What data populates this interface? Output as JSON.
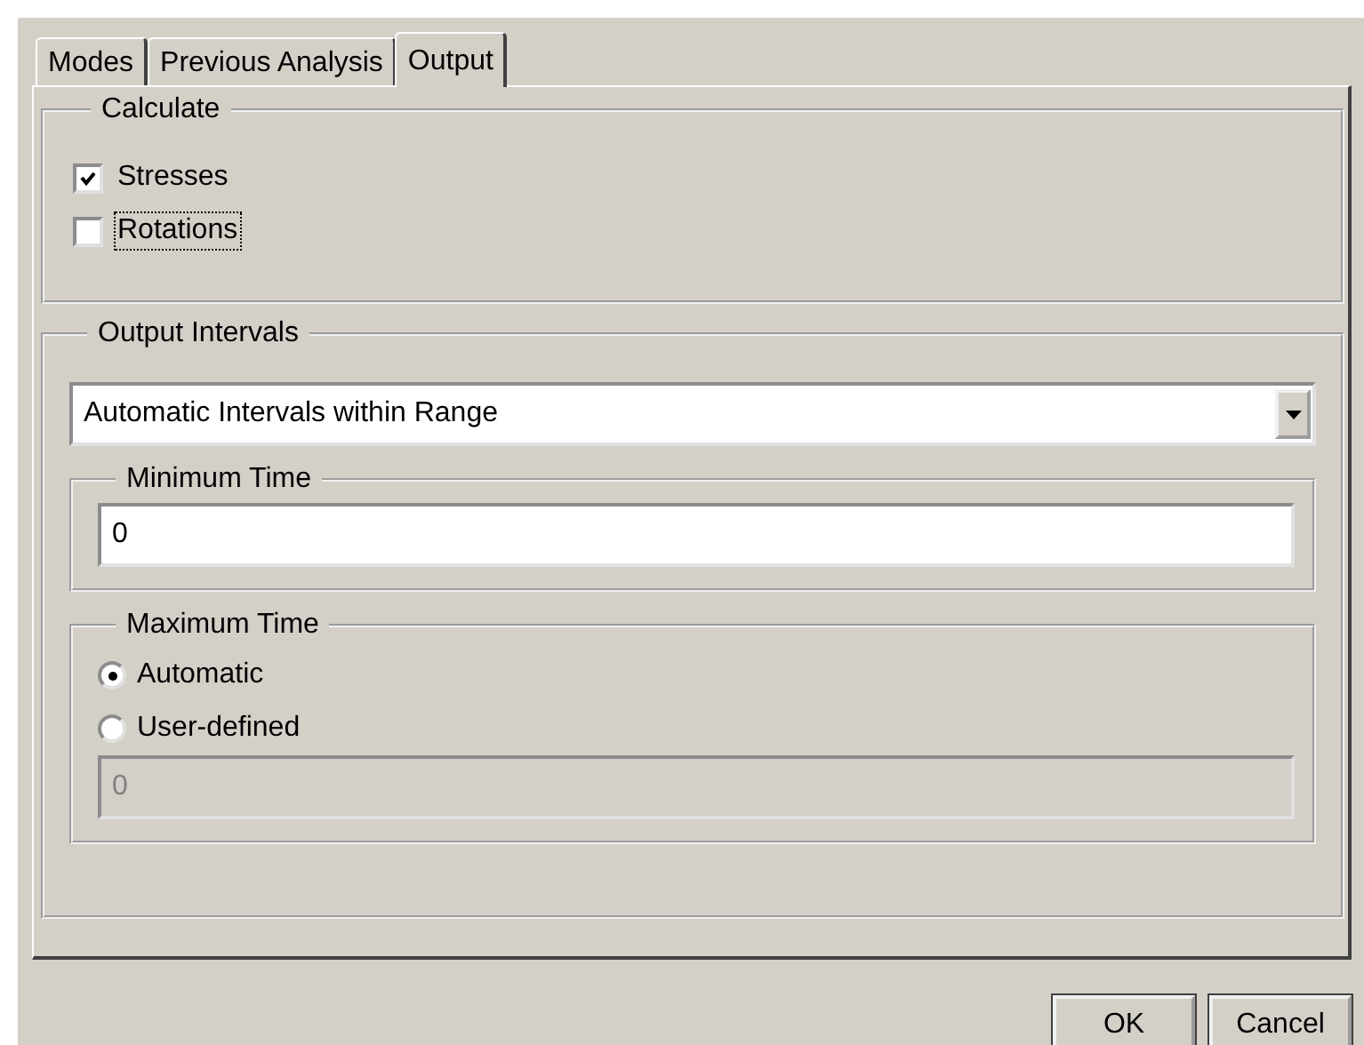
{
  "tabs": [
    {
      "label": "Modes",
      "selected": false
    },
    {
      "label": "Previous Analysis",
      "selected": false
    },
    {
      "label": "Output",
      "selected": true
    }
  ],
  "calculate": {
    "title": "Calculate",
    "options": [
      {
        "label": "Stresses",
        "checked": true,
        "focused": false
      },
      {
        "label": "Rotations",
        "checked": false,
        "focused": true
      }
    ]
  },
  "output_intervals": {
    "title": "Output Intervals",
    "dropdown": {
      "value": "Automatic Intervals within Range"
    },
    "minimum_time": {
      "title": "Minimum Time",
      "field": {
        "value": "0",
        "disabled": false
      }
    },
    "maximum_time": {
      "title": "Maximum Time",
      "options": [
        {
          "label": "Automatic",
          "selected": true
        },
        {
          "label": "User-defined",
          "selected": false
        }
      ],
      "field": {
        "value": "0",
        "disabled": true
      }
    }
  },
  "buttons": [
    {
      "label": "OK"
    },
    {
      "label": "Cancel"
    }
  ]
}
